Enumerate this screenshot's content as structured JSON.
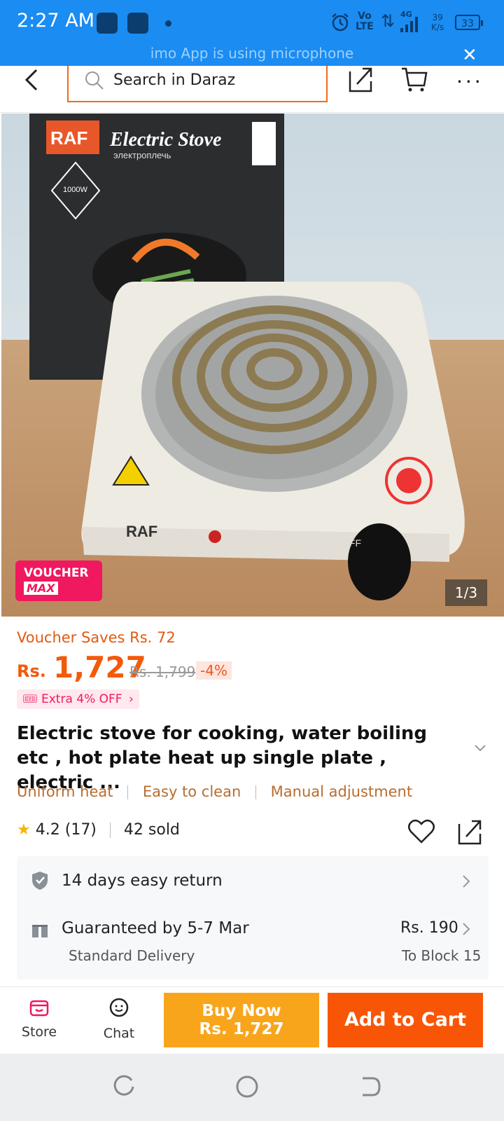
{
  "status_bar": {
    "time": "2:27 AM",
    "network_label": "Vo\nLTE",
    "net_gen": "4G",
    "speed": "39\nK/s",
    "battery": "33",
    "notice": "imo App is using microphone"
  },
  "nav": {
    "search_placeholder": "Search in Daraz"
  },
  "gallery": {
    "voucher_line1": "VOUCHER",
    "voucher_line2": "MAX",
    "counter": "1/3",
    "box_brand": "RAF",
    "box_title": "Electric Stove",
    "box_subtitle": "электроплечь",
    "box_power": "1000W",
    "stove_brand": "RAF",
    "knob_label": "OFF"
  },
  "pricing": {
    "voucher_saves": "Voucher Saves Rs. 72",
    "currency": "Rs.",
    "price": "1,727",
    "original_price": "Rs. 1,799",
    "discount": "-4%",
    "extra_offer": "Extra 4% OFF"
  },
  "product": {
    "title": "Electric stove for cooking, water boiling etc , hot plate heat up single plate , electric ...",
    "tags": [
      "Uniform heat",
      "Easy to clean",
      "Manual adjustment"
    ],
    "rating": "4.2",
    "reviews": "(17)",
    "sold": "42 sold"
  },
  "services": {
    "return_text": "14 days easy return",
    "delivery_title": "Guaranteed by 5-7 Mar",
    "delivery_type": "Standard Delivery",
    "delivery_fee": "Rs. 190",
    "delivery_to": "To Block 15"
  },
  "action_bar": {
    "store_label": "Store",
    "chat_label": "Chat",
    "buy_now_label": "Buy Now",
    "buy_now_price": "Rs. 1,727",
    "add_to_cart_label": "Add to Cart"
  },
  "colors": {
    "brand_orange": "#f85606",
    "buy_now_yellow": "#f8a51c",
    "status_blue": "#1a8cf2",
    "voucher_pink": "#f0185e"
  }
}
